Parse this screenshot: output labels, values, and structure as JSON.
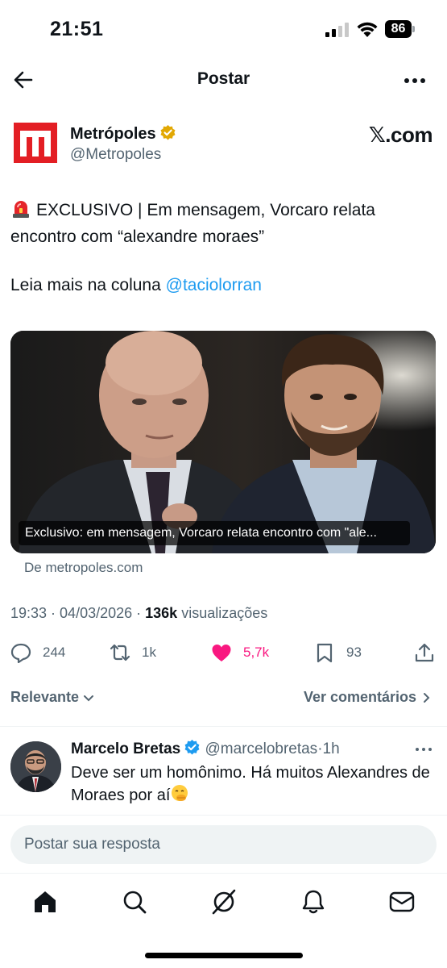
{
  "status_bar": {
    "time": "21:51",
    "battery": "86"
  },
  "header": {
    "title": "Postar"
  },
  "author": {
    "name": "Metrópoles",
    "handle": "@Metropoles",
    "source_badge": "𝕏.com"
  },
  "post": {
    "text": "EXCLUSIVO | Em mensagem, Vorcaro relata encontro com “alexandre moraes”",
    "read_more": "Leia mais na coluna ",
    "mention": "@taciolorran",
    "media_caption": "Exclusivo: em mensagem, Vorcaro relata encontro com \"ale...",
    "source": "De metropoles.com"
  },
  "meta": {
    "time": "19:33",
    "date": "04/03/2026",
    "views": "136k",
    "views_label": "visualizações"
  },
  "actions": {
    "replies": "244",
    "reposts": "1k",
    "likes": "5,7k",
    "bookmarks": "93"
  },
  "sort": {
    "left": "Relevante",
    "right": "Ver comentários"
  },
  "reply": {
    "name": "Marcelo Bretas",
    "handle": "@marcelobretas",
    "time": "1h",
    "text": "Deve ser um homônimo. Há muitos Alexandres de Moraes por aí"
  },
  "compose": {
    "placeholder": "Postar sua resposta"
  },
  "colors": {
    "accent": "#1d9bf0",
    "like": "#f91880",
    "brand": "#e31e24",
    "verified": "#f4b400"
  }
}
